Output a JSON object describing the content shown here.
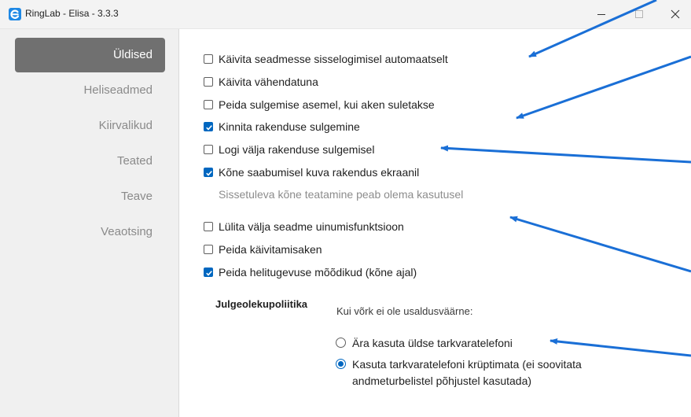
{
  "window": {
    "title": "RingLab - Elisa - 3.3.3"
  },
  "sidebar": {
    "items": [
      {
        "label": "Üldised",
        "active": true
      },
      {
        "label": "Heliseadmed",
        "active": false
      },
      {
        "label": "Kiirvalikud",
        "active": false
      },
      {
        "label": "Teated",
        "active": false
      },
      {
        "label": "Teave",
        "active": false
      },
      {
        "label": "Veaotsing",
        "active": false
      }
    ]
  },
  "options": [
    {
      "label": "Käivita seadmesse sisselogimisel automaatselt",
      "checked": false
    },
    {
      "label": "Käivita vähendatuna",
      "checked": false
    },
    {
      "label": "Peida sulgemise asemel, kui aken suletakse",
      "checked": false
    },
    {
      "label": "Kinnita rakenduse sulgemine",
      "checked": true
    },
    {
      "label": "Logi välja rakenduse sulgemisel",
      "checked": false
    },
    {
      "label": "Kõne saabumisel kuva rakendus ekraanil",
      "checked": true
    },
    {
      "label": "Lülita välja seadme uinumisfunktsioon",
      "checked": false
    },
    {
      "label": "Peida käivitamisaken",
      "checked": false
    },
    {
      "label": "Peida helitugevuse mõõdikud (kõne ajal)",
      "checked": true
    }
  ],
  "hint": "Sissetuleva kõne teatamine peab olema kasutusel",
  "security": {
    "title": "Julgeolekupoliitika",
    "question": "Kui võrk ei ole usaldusväärne:",
    "choices": [
      {
        "line1": "Ära kasuta üldse tarkvaratelefoni",
        "line2": "",
        "selected": false
      },
      {
        "line1": "Kasuta tarkvaratelefoni krüptimata (ei soovitata",
        "line2": "andmeturbelistel põhjustel kasutada)",
        "selected": true
      }
    ]
  },
  "colors": {
    "accent": "#0067c0",
    "annotation_arrow": "#1a6fd6",
    "sidebar_active_bg": "#707070"
  }
}
